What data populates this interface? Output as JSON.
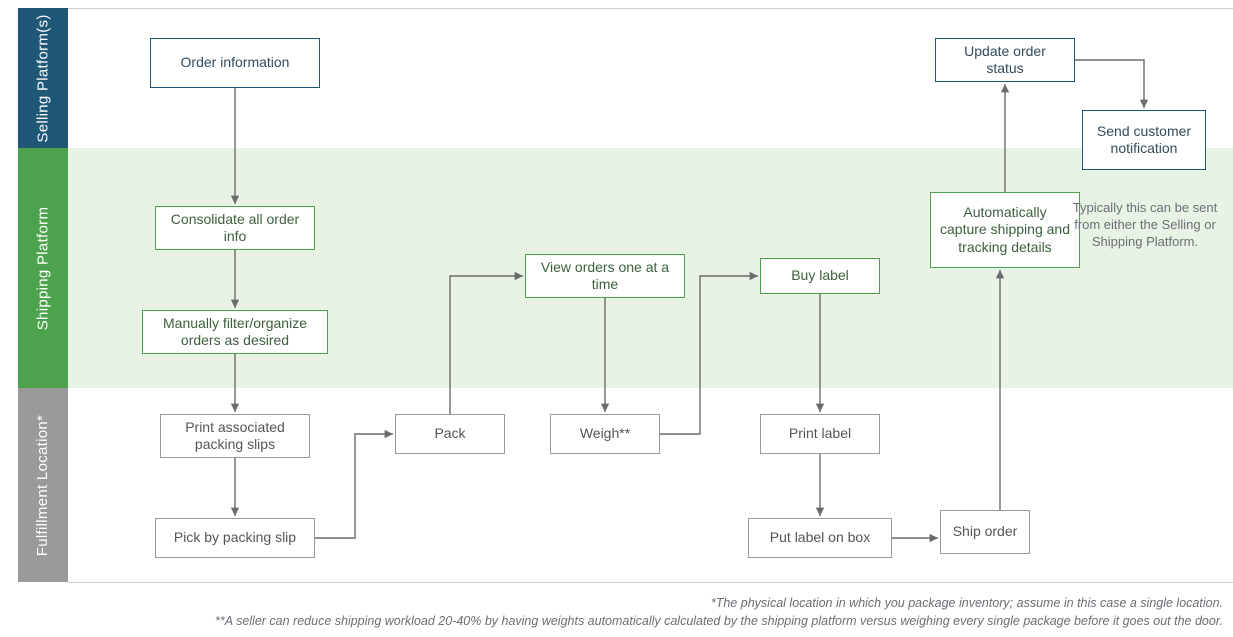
{
  "lanes": {
    "selling": "Selling Platform(s)",
    "shipping": "Shipping Platform",
    "fulfillment": "Fulfillment Location*"
  },
  "nodes": {
    "order_info": "Order information",
    "update_status": "Update order status",
    "send_notification": "Send customer notification",
    "consolidate": "Consolidate all order info",
    "filter": "Manually filter/organize orders as desired",
    "view_orders": "View orders one at a time",
    "buy_label": "Buy label",
    "capture": "Automatically capture shipping and tracking details",
    "print_slips": "Print associated packing slips",
    "pack": "Pack",
    "weigh": "Weigh**",
    "print_label": "Print label",
    "pick": "Pick by packing slip",
    "put_label": "Put label on box",
    "ship": "Ship order"
  },
  "notes": {
    "either_platform": "Typically this can be sent from either the Selling or Shipping Platform."
  },
  "footnotes": {
    "one": "*The physical location in which you package inventory; assume in this case a single location.",
    "two": "**A seller can reduce shipping workload 20-40% by having weights automatically calculated by the shipping platform versus weighing every single package before it goes out the door."
  }
}
